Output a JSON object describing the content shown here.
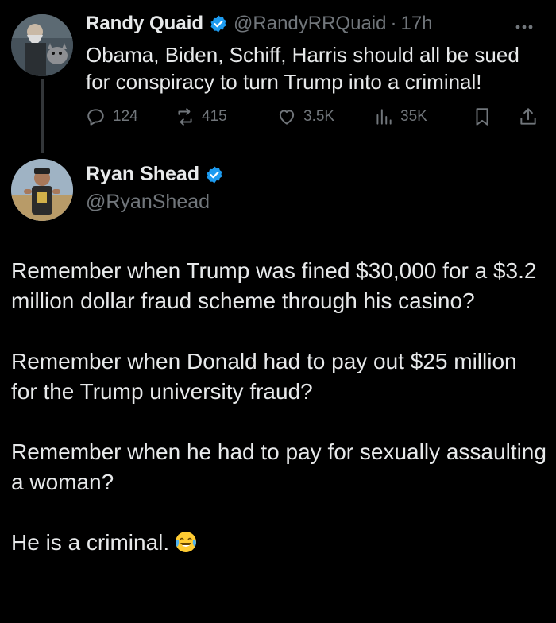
{
  "tweet1": {
    "display_name": "Randy Quaid",
    "handle": "@RandyRRQuaid",
    "separator": "·",
    "time": "17h",
    "text": "Obama, Biden, Schiff, Harris should all be sued for conspiracy to turn Trump into a criminal!",
    "avatar_icon": "avatar-man-with-dog",
    "actions": {
      "replies": "124",
      "reposts": "415",
      "likes": "3.5K",
      "views": "35K"
    }
  },
  "tweet2": {
    "display_name": "Ryan Shead",
    "handle": "@RyanShead",
    "avatar_icon": "avatar-man-outdoors",
    "paragraphs": [
      "Remember when Trump was fined $30,000 for a $3.2 million dollar fraud scheme through his casino?",
      "Remember when Donald had to pay out $25 million for the Trump university fraud?",
      "Remember when he had to pay for sexually assaulting a woman?",
      "He is a criminal."
    ],
    "trailing_emoji": "face-with-tears-of-joy"
  },
  "colors": {
    "background": "#000000",
    "text_primary": "#e7e9ea",
    "text_muted": "#71767b",
    "verified_blue": "#1d9bf0",
    "thread_line": "#333639"
  }
}
